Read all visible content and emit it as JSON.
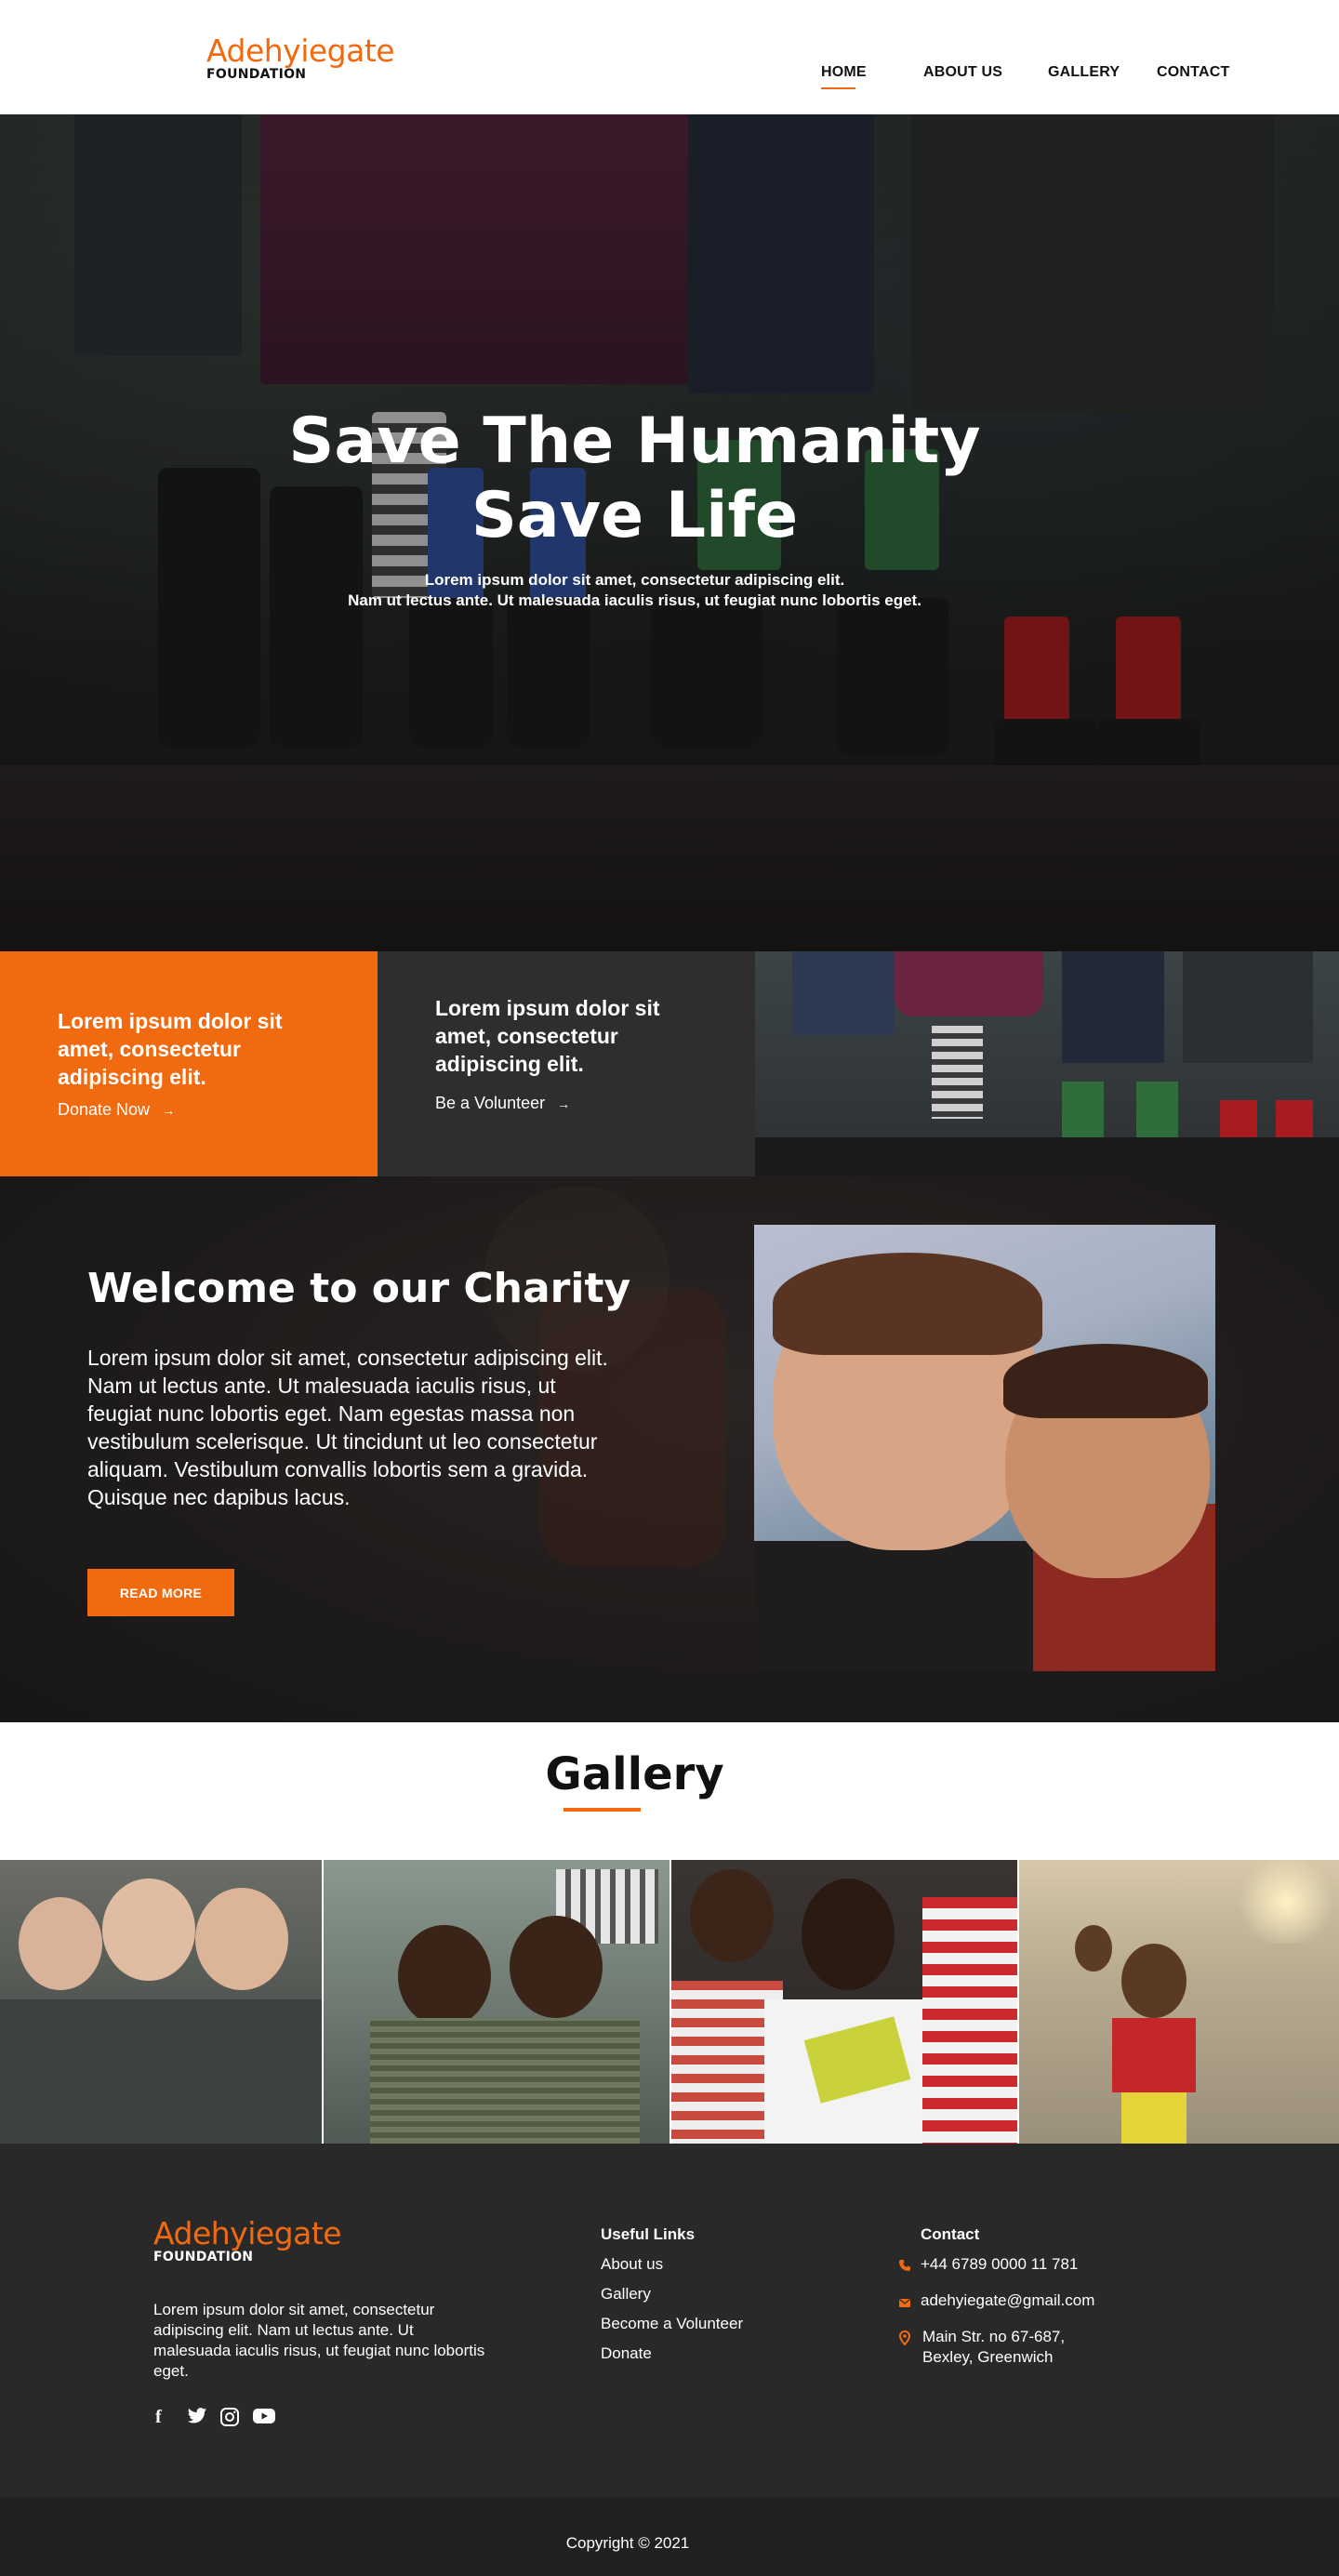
{
  "brand": {
    "name": "Adehyiegate",
    "sub": "FOUNDATION",
    "accent": "#f26a0f",
    "dark": "#2a2929"
  },
  "nav": {
    "items": [
      {
        "label": "HOME",
        "active": true
      },
      {
        "label": "ABOUT US",
        "active": false
      },
      {
        "label": "GALLERY",
        "active": false
      },
      {
        "label": "CONTACT",
        "active": false
      }
    ]
  },
  "hero": {
    "title_line1": "Save The Humanity",
    "title_line2": "Save Life",
    "subtitle_line1": "Lorem ipsum dolor sit amet, consectetur adipiscing elit.",
    "subtitle_line2": "Nam ut lectus ante. Ut malesuada iaculis risus, ut feugiat nunc lobortis eget."
  },
  "cards": [
    {
      "title": "Lorem ipsum dolor sit amet, consectetur adipiscing elit.",
      "link": "Donate Now"
    },
    {
      "title": "Lorem ipsum dolor sit amet, consectetur adipiscing elit.",
      "link": "Be a Volunteer"
    }
  ],
  "welcome": {
    "title": "Welcome to our Charity",
    "text": "Lorem ipsum dolor sit amet, consectetur adipiscing elit. Nam ut lectus ante. Ut malesuada iaculis risus, ut feugiat nunc lobortis eget. Nam egestas massa non vestibulum scelerisque. Ut tincidunt ut leo consectetur aliquam. Vestibulum convallis lobortis sem a gravida. Quisque nec dapibus lacus.",
    "button": "READ MORE"
  },
  "gallery": {
    "title": "Gallery"
  },
  "footer": {
    "about": "Lorem ipsum dolor sit amet, consectetur adipiscing elit. Nam ut lectus ante. Ut malesuada iaculis risus, ut feugiat nunc lobortis eget.",
    "socials": [
      "facebook-icon",
      "twitter-icon",
      "instagram-icon",
      "youtube-icon"
    ],
    "useful_links_title": "Useful Links",
    "useful_links": [
      "About us",
      "Gallery",
      "Become a Volunteer",
      "Donate"
    ],
    "contact_title": "Contact",
    "phone": "+44 6789 0000 11 781",
    "email": "adehyiegate@gmail.com",
    "address_line1": "Main Str. no 67-687,",
    "address_line2": "Bexley, Greenwich"
  },
  "copyright": "Copyright © 2021"
}
